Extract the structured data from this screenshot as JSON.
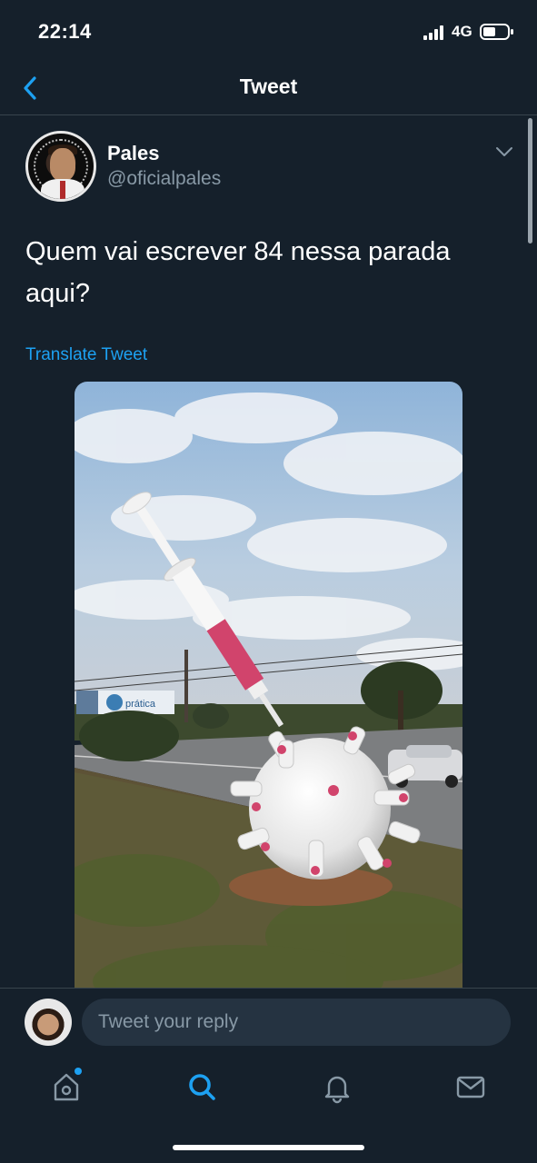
{
  "status_bar": {
    "time": "22:14",
    "network": "4G"
  },
  "nav": {
    "title": "Tweet"
  },
  "tweet": {
    "author_name": "Pales",
    "author_handle": "@oficialpales",
    "avatar_badge_top": "SOMETIMES ANTISOCIAL",
    "avatar_badge_bottom": "ALWAYS ANTIFASCIST",
    "text": "Quem vai escrever 84 nessa parada aqui?",
    "translate_label": "Translate Tweet",
    "photo_sign_text": "prática"
  },
  "reply": {
    "placeholder": "Tweet your reply"
  },
  "tabs": [
    {
      "name": "home",
      "icon": "home-icon",
      "notification_dot": true
    },
    {
      "name": "search",
      "icon": "search-icon",
      "active": true
    },
    {
      "name": "notifications",
      "icon": "bell-icon"
    },
    {
      "name": "messages",
      "icon": "mail-icon"
    }
  ],
  "colors": {
    "background": "#15202b",
    "accent": "#1da1f2",
    "secondary_text": "#8899a6",
    "divider": "#38444d"
  }
}
